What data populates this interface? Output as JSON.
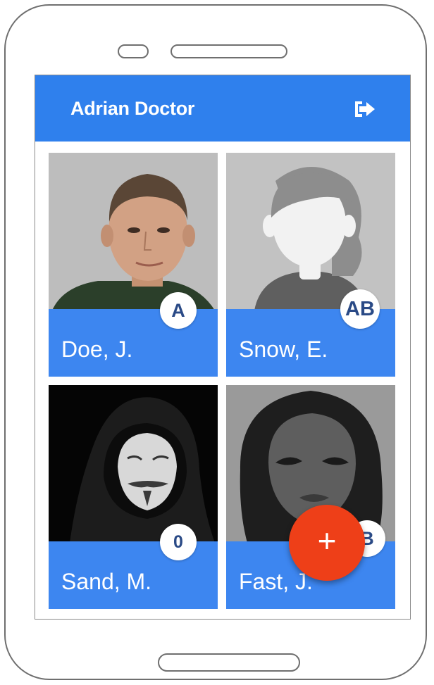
{
  "app_bar": {
    "title": "Adrian Doctor",
    "logout_icon": "sign-out-icon",
    "color": "#2f80ed"
  },
  "patients": [
    {
      "name": "Doe, J.",
      "badge": "A",
      "photo": "young-man-portrait"
    },
    {
      "name": "Snow, E.",
      "badge": "AB",
      "photo": "default-female-avatar"
    },
    {
      "name": "Sand, M.",
      "badge": "0",
      "photo": "hooded-mask-portrait"
    },
    {
      "name": "Fast, J.",
      "badge": "B",
      "photo": "woman-bw-portrait"
    }
  ],
  "fab": {
    "label": "+",
    "color": "#ee3f18"
  },
  "colors": {
    "name_bar": "#3d86f0",
    "badge_text": "#2a4a86"
  }
}
